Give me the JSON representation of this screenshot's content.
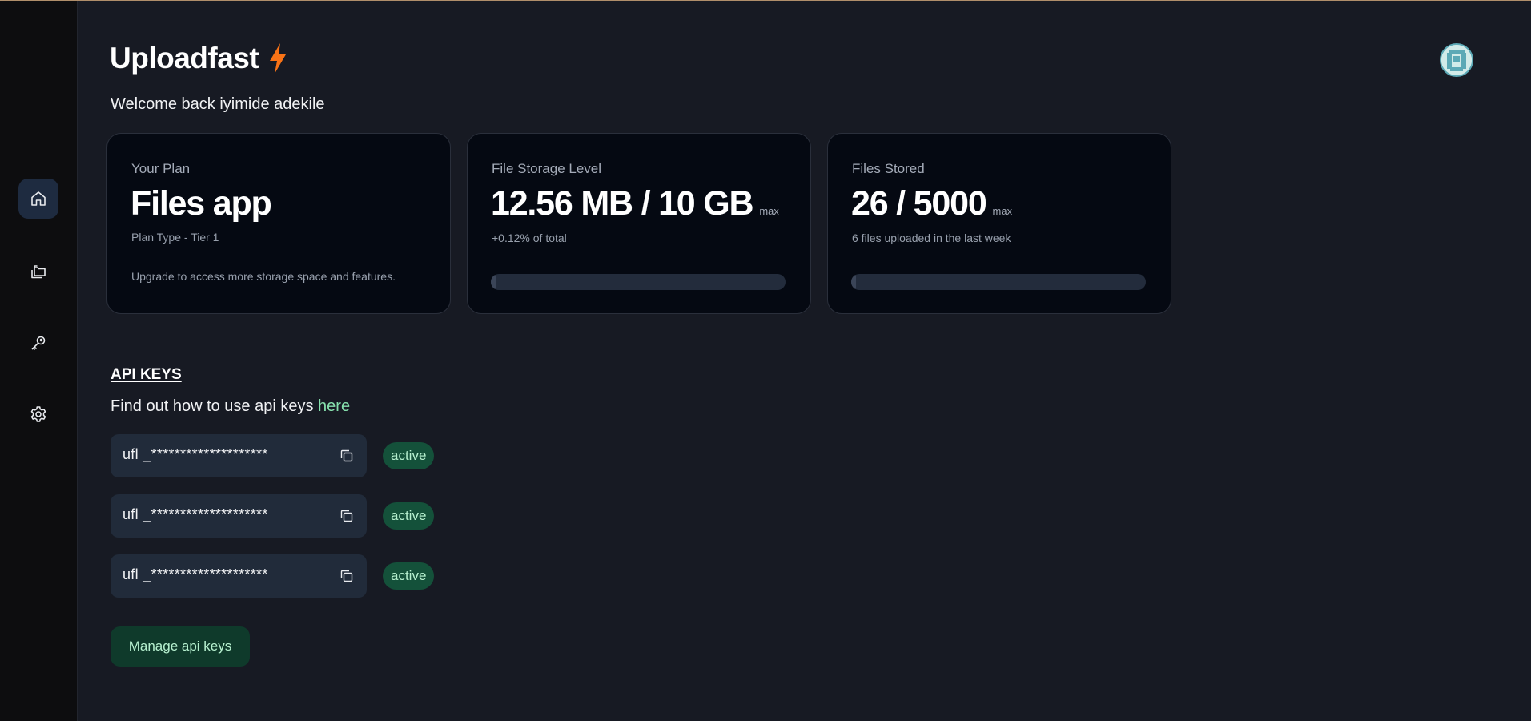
{
  "app": {
    "title": "Uploadfast",
    "welcome": "Welcome back iyimide adekile"
  },
  "sidebar": {
    "items": [
      {
        "name": "home",
        "icon": "home-icon",
        "active": true
      },
      {
        "name": "files",
        "icon": "folders-icon",
        "active": false
      },
      {
        "name": "api-keys",
        "icon": "key-icon",
        "active": false
      },
      {
        "name": "settings",
        "icon": "gear-icon",
        "active": false
      }
    ]
  },
  "cards": {
    "plan": {
      "label": "Your Plan",
      "value": "Files app",
      "sub": "Plan Type - Tier 1",
      "desc": "Upgrade to access more storage space and features."
    },
    "storage": {
      "label": "File Storage Level",
      "value": "12.56 MB / 10 GB",
      "max": "max",
      "sub": "+0.12% of total",
      "progress_percent": 0.12
    },
    "files": {
      "label": "Files Stored",
      "value": "26 / 5000",
      "max": "max",
      "sub": "6 files uploaded in the last week",
      "progress_percent": 0.52
    }
  },
  "api": {
    "title": "API KEYS",
    "help_prefix": "Find out how to use api keys",
    "help_link": "here",
    "keys": [
      {
        "masked": "ufl _********************",
        "status": "active"
      },
      {
        "masked": "ufl _********************",
        "status": "active"
      },
      {
        "masked": "ufl _********************",
        "status": "active"
      }
    ],
    "manage_label": "Manage api keys"
  },
  "colors": {
    "accent_green": "#86e0ad",
    "badge_bg": "#14513a",
    "bolt": "#f97316",
    "background": "#171a23",
    "sidebar": "#0d0d0f"
  }
}
